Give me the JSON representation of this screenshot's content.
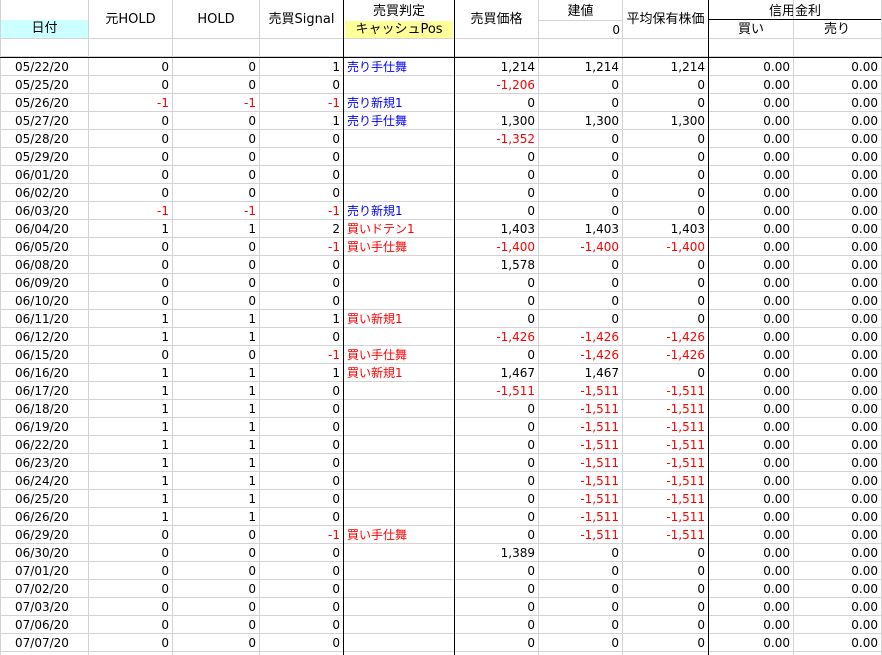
{
  "header": {
    "date": "日付",
    "orig_hold": "元HOLD",
    "hold": "HOLD",
    "signal": "売買Signal",
    "judge": "売買判定",
    "cash_pos": "キャッシュPos",
    "price": "売買価格",
    "position": "建値",
    "position_value": "0",
    "avg_price": "平均保有株価",
    "margin": "信用金利",
    "buy": "買い",
    "sell": "売り"
  },
  "colors": {
    "date_header_bg": "#ccffff",
    "cash_pos_bg": "#ffff99",
    "red": "#ff0000",
    "blue": "#0000ff"
  },
  "rows": [
    {
      "date": "05/22/20",
      "orig": "0",
      "hold": "0",
      "sig": "1",
      "judge": "売り手仕舞",
      "jc": "blue",
      "price": "1,214",
      "pos": "1,214",
      "avg": "1,214",
      "buy": "0.00",
      "sell": "0.00"
    },
    {
      "date": "05/25/20",
      "orig": "0",
      "hold": "0",
      "sig": "0",
      "judge": "",
      "jc": "",
      "price": "-1,206",
      "pos": "0",
      "avg": "0",
      "buy": "0.00",
      "sell": "0.00"
    },
    {
      "date": "05/26/20",
      "orig": "-1",
      "hold": "-1",
      "sig": "-1",
      "judge": "売り新規1",
      "jc": "blue",
      "price": "0",
      "pos": "0",
      "avg": "0",
      "buy": "0.00",
      "sell": "0.00"
    },
    {
      "date": "05/27/20",
      "orig": "0",
      "hold": "0",
      "sig": "1",
      "judge": "売り手仕舞",
      "jc": "blue",
      "price": "1,300",
      "pos": "1,300",
      "avg": "1,300",
      "buy": "0.00",
      "sell": "0.00"
    },
    {
      "date": "05/28/20",
      "orig": "0",
      "hold": "0",
      "sig": "0",
      "judge": "",
      "jc": "",
      "price": "-1,352",
      "pos": "0",
      "avg": "0",
      "buy": "0.00",
      "sell": "0.00"
    },
    {
      "date": "05/29/20",
      "orig": "0",
      "hold": "0",
      "sig": "0",
      "judge": "",
      "jc": "",
      "price": "0",
      "pos": "0",
      "avg": "0",
      "buy": "0.00",
      "sell": "0.00"
    },
    {
      "date": "06/01/20",
      "orig": "0",
      "hold": "0",
      "sig": "0",
      "judge": "",
      "jc": "",
      "price": "0",
      "pos": "0",
      "avg": "0",
      "buy": "0.00",
      "sell": "0.00"
    },
    {
      "date": "06/02/20",
      "orig": "0",
      "hold": "0",
      "sig": "0",
      "judge": "",
      "jc": "",
      "price": "0",
      "pos": "0",
      "avg": "0",
      "buy": "0.00",
      "sell": "0.00"
    },
    {
      "date": "06/03/20",
      "orig": "-1",
      "hold": "-1",
      "sig": "-1",
      "judge": "売り新規1",
      "jc": "blue",
      "price": "0",
      "pos": "0",
      "avg": "0",
      "buy": "0.00",
      "sell": "0.00"
    },
    {
      "date": "06/04/20",
      "orig": "1",
      "hold": "1",
      "sig": "2",
      "judge": "買いドテン1",
      "jc": "red",
      "price": "1,403",
      "pos": "1,403",
      "avg": "1,403",
      "buy": "0.00",
      "sell": "0.00"
    },
    {
      "date": "06/05/20",
      "orig": "0",
      "hold": "0",
      "sig": "-1",
      "judge": "買い手仕舞",
      "jc": "red",
      "price": "-1,400",
      "pos": "-1,400",
      "avg": "-1,400",
      "buy": "0.00",
      "sell": "0.00"
    },
    {
      "date": "06/08/20",
      "orig": "0",
      "hold": "0",
      "sig": "0",
      "judge": "",
      "jc": "",
      "price": "1,578",
      "pos": "0",
      "avg": "0",
      "buy": "0.00",
      "sell": "0.00"
    },
    {
      "date": "06/09/20",
      "orig": "0",
      "hold": "0",
      "sig": "0",
      "judge": "",
      "jc": "",
      "price": "0",
      "pos": "0",
      "avg": "0",
      "buy": "0.00",
      "sell": "0.00"
    },
    {
      "date": "06/10/20",
      "orig": "0",
      "hold": "0",
      "sig": "0",
      "judge": "",
      "jc": "",
      "price": "0",
      "pos": "0",
      "avg": "0",
      "buy": "0.00",
      "sell": "0.00"
    },
    {
      "date": "06/11/20",
      "orig": "1",
      "hold": "1",
      "sig": "1",
      "judge": "買い新規1",
      "jc": "red",
      "price": "0",
      "pos": "0",
      "avg": "0",
      "buy": "0.00",
      "sell": "0.00"
    },
    {
      "date": "06/12/20",
      "orig": "1",
      "hold": "1",
      "sig": "0",
      "judge": "",
      "jc": "",
      "price": "-1,426",
      "pos": "-1,426",
      "avg": "-1,426",
      "buy": "0.00",
      "sell": "0.00"
    },
    {
      "date": "06/15/20",
      "orig": "0",
      "hold": "0",
      "sig": "-1",
      "judge": "買い手仕舞",
      "jc": "red",
      "price": "0",
      "pos": "-1,426",
      "avg": "-1,426",
      "buy": "0.00",
      "sell": "0.00"
    },
    {
      "date": "06/16/20",
      "orig": "1",
      "hold": "1",
      "sig": "1",
      "judge": "買い新規1",
      "jc": "red",
      "price": "1,467",
      "pos": "1,467",
      "avg": "0",
      "buy": "0.00",
      "sell": "0.00"
    },
    {
      "date": "06/17/20",
      "orig": "1",
      "hold": "1",
      "sig": "0",
      "judge": "",
      "jc": "",
      "price": "-1,511",
      "pos": "-1,511",
      "avg": "-1,511",
      "buy": "0.00",
      "sell": "0.00"
    },
    {
      "date": "06/18/20",
      "orig": "1",
      "hold": "1",
      "sig": "0",
      "judge": "",
      "jc": "",
      "price": "0",
      "pos": "-1,511",
      "avg": "-1,511",
      "buy": "0.00",
      "sell": "0.00"
    },
    {
      "date": "06/19/20",
      "orig": "1",
      "hold": "1",
      "sig": "0",
      "judge": "",
      "jc": "",
      "price": "0",
      "pos": "-1,511",
      "avg": "-1,511",
      "buy": "0.00",
      "sell": "0.00"
    },
    {
      "date": "06/22/20",
      "orig": "1",
      "hold": "1",
      "sig": "0",
      "judge": "",
      "jc": "",
      "price": "0",
      "pos": "-1,511",
      "avg": "-1,511",
      "buy": "0.00",
      "sell": "0.00"
    },
    {
      "date": "06/23/20",
      "orig": "1",
      "hold": "1",
      "sig": "0",
      "judge": "",
      "jc": "",
      "price": "0",
      "pos": "-1,511",
      "avg": "-1,511",
      "buy": "0.00",
      "sell": "0.00"
    },
    {
      "date": "06/24/20",
      "orig": "1",
      "hold": "1",
      "sig": "0",
      "judge": "",
      "jc": "",
      "price": "0",
      "pos": "-1,511",
      "avg": "-1,511",
      "buy": "0.00",
      "sell": "0.00"
    },
    {
      "date": "06/25/20",
      "orig": "1",
      "hold": "1",
      "sig": "0",
      "judge": "",
      "jc": "",
      "price": "0",
      "pos": "-1,511",
      "avg": "-1,511",
      "buy": "0.00",
      "sell": "0.00"
    },
    {
      "date": "06/26/20",
      "orig": "1",
      "hold": "1",
      "sig": "0",
      "judge": "",
      "jc": "",
      "price": "0",
      "pos": "-1,511",
      "avg": "-1,511",
      "buy": "0.00",
      "sell": "0.00"
    },
    {
      "date": "06/29/20",
      "orig": "0",
      "hold": "0",
      "sig": "-1",
      "judge": "買い手仕舞",
      "jc": "red",
      "price": "0",
      "pos": "-1,511",
      "avg": "-1,511",
      "buy": "0.00",
      "sell": "0.00"
    },
    {
      "date": "06/30/20",
      "orig": "0",
      "hold": "0",
      "sig": "0",
      "judge": "",
      "jc": "",
      "price": "1,389",
      "pos": "0",
      "avg": "0",
      "buy": "0.00",
      "sell": "0.00"
    },
    {
      "date": "07/01/20",
      "orig": "0",
      "hold": "0",
      "sig": "0",
      "judge": "",
      "jc": "",
      "price": "0",
      "pos": "0",
      "avg": "0",
      "buy": "0.00",
      "sell": "0.00"
    },
    {
      "date": "07/02/20",
      "orig": "0",
      "hold": "0",
      "sig": "0",
      "judge": "",
      "jc": "",
      "price": "0",
      "pos": "0",
      "avg": "0",
      "buy": "0.00",
      "sell": "0.00"
    },
    {
      "date": "07/03/20",
      "orig": "0",
      "hold": "0",
      "sig": "0",
      "judge": "",
      "jc": "",
      "price": "0",
      "pos": "0",
      "avg": "0",
      "buy": "0.00",
      "sell": "0.00"
    },
    {
      "date": "07/06/20",
      "orig": "0",
      "hold": "0",
      "sig": "0",
      "judge": "",
      "jc": "",
      "price": "0",
      "pos": "0",
      "avg": "0",
      "buy": "0.00",
      "sell": "0.00"
    },
    {
      "date": "07/07/20",
      "orig": "0",
      "hold": "0",
      "sig": "0",
      "judge": "",
      "jc": "",
      "price": "0",
      "pos": "0",
      "avg": "0",
      "buy": "0.00",
      "sell": "0.00"
    }
  ]
}
